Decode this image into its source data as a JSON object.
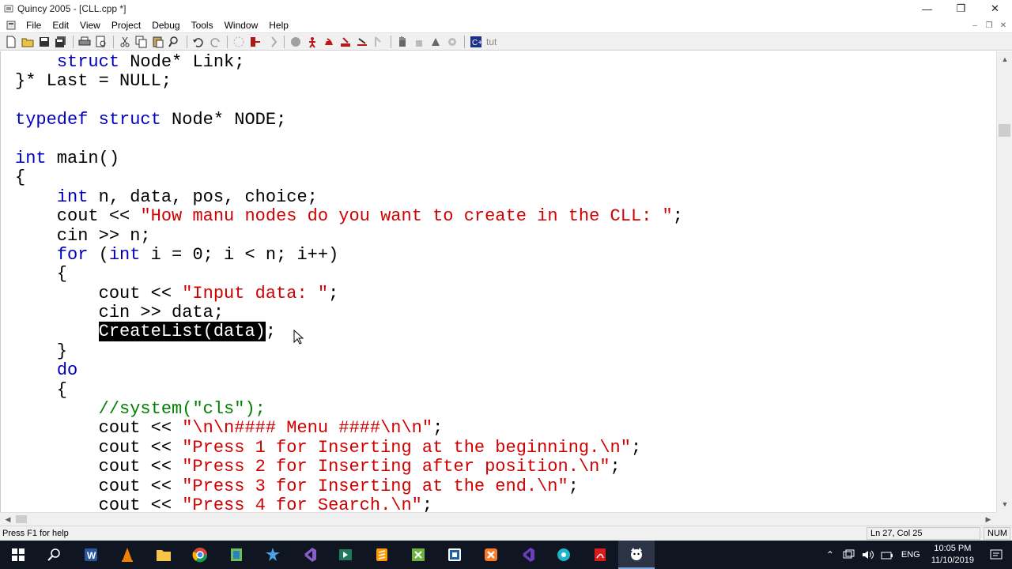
{
  "window": {
    "title": "Quincy 2005 - [CLL.cpp *]",
    "controls": {
      "minimize": "—",
      "maximize": "❐",
      "close": "✕"
    }
  },
  "menu": {
    "items": [
      "File",
      "Edit",
      "View",
      "Project",
      "Debug",
      "Tools",
      "Window",
      "Help"
    ],
    "mdi": {
      "minimize": "–",
      "restore": "❐",
      "close": "✕"
    }
  },
  "toolbar": {
    "text_button": "tut"
  },
  "editor": {
    "lines": [
      [
        {
          "t": "    "
        },
        {
          "t": "struct",
          "c": "kw"
        },
        {
          "t": " Node* Link;"
        }
      ],
      [
        {
          "t": "}* Last = NULL;"
        }
      ],
      [
        {
          "t": ""
        }
      ],
      [
        {
          "t": "typedef",
          "c": "kw"
        },
        {
          "t": " "
        },
        {
          "t": "struct",
          "c": "kw"
        },
        {
          "t": " Node* NODE;"
        }
      ],
      [
        {
          "t": ""
        }
      ],
      [
        {
          "t": "int",
          "c": "kw"
        },
        {
          "t": " main()"
        }
      ],
      [
        {
          "t": "{"
        }
      ],
      [
        {
          "t": "    "
        },
        {
          "t": "int",
          "c": "kw"
        },
        {
          "t": " n, data, pos, choice;"
        }
      ],
      [
        {
          "t": "    cout << "
        },
        {
          "t": "\"How manu nodes do you want to create in the CLL: \"",
          "c": "str"
        },
        {
          "t": ";"
        }
      ],
      [
        {
          "t": "    cin >> n;"
        }
      ],
      [
        {
          "t": "    "
        },
        {
          "t": "for",
          "c": "kw"
        },
        {
          "t": " ("
        },
        {
          "t": "int",
          "c": "kw"
        },
        {
          "t": " i = 0; i < n; i++)"
        }
      ],
      [
        {
          "t": "    {"
        }
      ],
      [
        {
          "t": "        cout << "
        },
        {
          "t": "\"Input data: \"",
          "c": "str"
        },
        {
          "t": ";"
        }
      ],
      [
        {
          "t": "        cin >> data;"
        }
      ],
      [
        {
          "t": "        "
        },
        {
          "t": "CreateList(data)",
          "c": "sel"
        },
        {
          "t": ";"
        }
      ],
      [
        {
          "t": "    }"
        }
      ],
      [
        {
          "t": "    "
        },
        {
          "t": "do",
          "c": "kw"
        }
      ],
      [
        {
          "t": "    {"
        }
      ],
      [
        {
          "t": "        "
        },
        {
          "t": "//system(\"cls\");",
          "c": "cmt"
        }
      ],
      [
        {
          "t": "        cout << "
        },
        {
          "t": "\"\\n\\n#### Menu ####\\n\\n\"",
          "c": "str"
        },
        {
          "t": ";"
        }
      ],
      [
        {
          "t": "        cout << "
        },
        {
          "t": "\"Press 1 for Inserting at the beginning.\\n\"",
          "c": "str"
        },
        {
          "t": ";"
        }
      ],
      [
        {
          "t": "        cout << "
        },
        {
          "t": "\"Press 2 for Inserting after position.\\n\"",
          "c": "str"
        },
        {
          "t": ";"
        }
      ],
      [
        {
          "t": "        cout << "
        },
        {
          "t": "\"Press 3 for Inserting at the end.\\n\"",
          "c": "str"
        },
        {
          "t": ";"
        }
      ],
      [
        {
          "t": "        cout << "
        },
        {
          "t": "\"Press 4 for Search.\\n\"",
          "c": "str"
        },
        {
          "t": ";"
        }
      ]
    ]
  },
  "status": {
    "help": "Press F1 for help",
    "position": "Ln 27, Col 25",
    "num": "NUM"
  },
  "taskbar": {
    "clock_time": "10:05 PM",
    "clock_date": "11/10/2019",
    "language": "ENG"
  },
  "colors": {
    "keyword": "#0000c0",
    "string": "#d00000",
    "comment": "#008000",
    "taskbar": "#101522"
  }
}
